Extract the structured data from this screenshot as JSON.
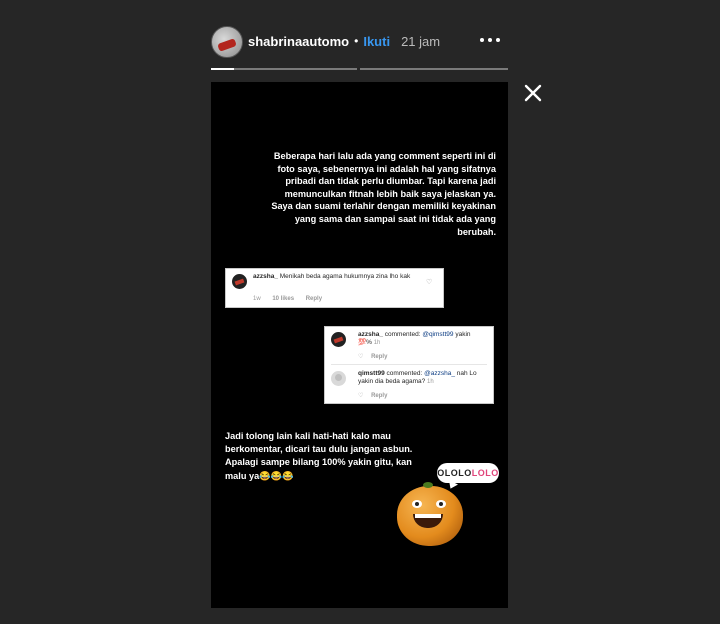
{
  "header": {
    "username": "shabrinaautomo",
    "separator": "•",
    "follow_label": "Ikuti",
    "time": "21 jam",
    "more_icon": "more-dots-icon",
    "close_icon": "close-icon"
  },
  "progress": {
    "segments": 2,
    "active_index": 0,
    "active_fill": 0.25
  },
  "story": {
    "paragraph1": "Beberapa hari lalu ada yang comment seperti ini di foto saya,  sebenernya  ini adalah hal yang sifatnya pribadi dan tidak perlu diumbar. Tapi karena jadi memunculkan fitnah lebih baik saya jelaskan ya. Saya dan suami terlahir dengan memiliki keyakinan yang sama dan sampai saat ini tidak ada yang berubah.",
    "comment1": {
      "username": "azzsha_",
      "text": "Menikah beda agama hukumnya zina lho kak",
      "time": "1w",
      "likes": "10 likes",
      "reply": "Reply"
    },
    "comment2": {
      "username": "azzsha_",
      "action": "commented:",
      "mention": "@qimstt99",
      "text": "yakin 💯%",
      "time": "1h",
      "reply": "Reply"
    },
    "comment3": {
      "username": "qimstt99",
      "action": "commented:",
      "mention": "@azzsha_",
      "text": "nah Lo yakin dia beda agama?",
      "time": "1h",
      "reply": "Reply"
    },
    "paragraph2": "Jadi  tolong lain kali hati-hati  kalo mau berkomentar, dicari tau dulu jangan asbun. Apalagi sampe bilang 100% yakin  gitu, kan malu ya😂😂😂",
    "sticker_text_part1": "OLOLO",
    "sticker_text_part2": "LOLO"
  }
}
